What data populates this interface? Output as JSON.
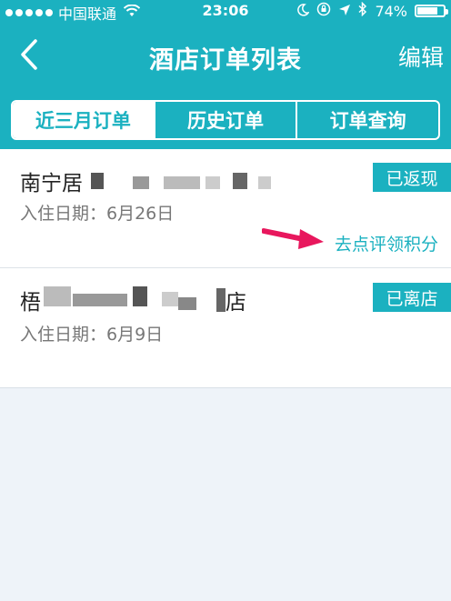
{
  "status_bar": {
    "carrier": "中国联通",
    "time": "23:06",
    "battery": "74%",
    "signal_icon": "signal-dots-icon",
    "wifi_icon": "wifi-icon",
    "moon_icon": "moon-icon",
    "lock_icon": "orientation-lock-icon",
    "location_icon": "location-arrow-icon",
    "bluetooth_icon": "bluetooth-icon",
    "battery_icon": "battery-icon"
  },
  "nav": {
    "title": "酒店订单列表",
    "edit_label": "编辑",
    "back_icon": "chevron-left-icon"
  },
  "tabs": [
    {
      "label": "近三月订单",
      "active": true
    },
    {
      "label": "历史订单",
      "active": false
    },
    {
      "label": "订单查询",
      "active": false
    }
  ],
  "orders": [
    {
      "name_visible": "南宁居",
      "checkin_label": "入住日期：6月26日",
      "status": "已返现",
      "action": "去点评领积分"
    },
    {
      "name_visible": "梧",
      "name_suffix": "店",
      "checkin_label": "入住日期：6月9日",
      "status": "已离店"
    }
  ],
  "colors": {
    "accent": "#1bb1c0",
    "arrow": "#e8175d",
    "background": "#eef3f9"
  }
}
